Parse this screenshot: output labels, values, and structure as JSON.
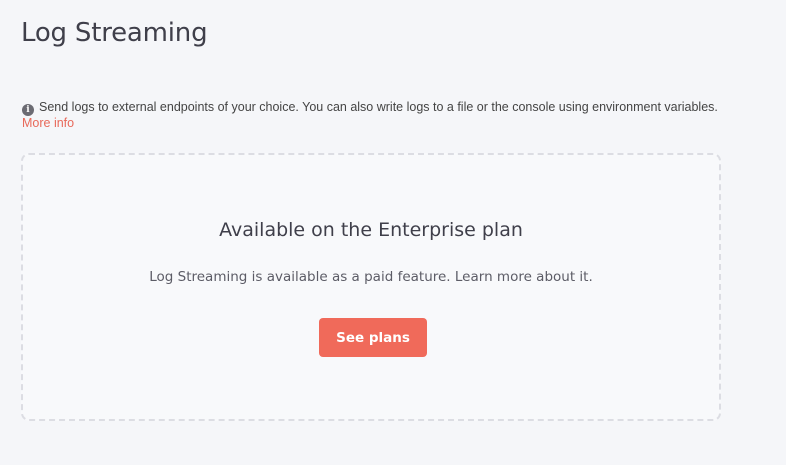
{
  "page": {
    "title": "Log Streaming"
  },
  "info": {
    "icon": "info-icon",
    "icon_glyph": "i",
    "text": "Send logs to external endpoints of your choice. You can also write logs to a file or the console using environment variables.",
    "link_label": "More info"
  },
  "upgrade": {
    "heading": "Available on the Enterprise plan",
    "text": "Log Streaming is available as a paid feature. Learn more about it.",
    "button_label": "See plans"
  },
  "colors": {
    "accent": "#f06a5a",
    "link": "#e8695a",
    "background": "#f5f6f9"
  }
}
